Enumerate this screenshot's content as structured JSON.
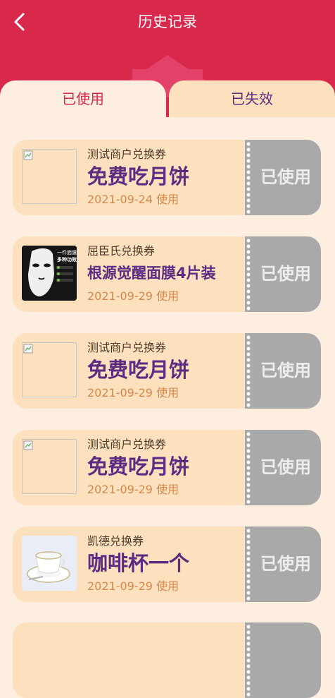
{
  "header": {
    "title": "历史记录",
    "background_color": "#d8284c"
  },
  "tabs": [
    {
      "label": "已使用",
      "active": true
    },
    {
      "label": "已失效",
      "active": false
    }
  ],
  "coupons": [
    {
      "merchant": "测试商户兑换券",
      "name": "免费吃月饼",
      "date": "2021-09-24 使用",
      "status": "已使用",
      "image": "broken"
    },
    {
      "merchant": "屈臣氏兑换券",
      "name": "根源觉醒面膜4片装",
      "date": "2021-09-29 使用",
      "status": "已使用",
      "image": "face-mask",
      "image_caption_line1": "一件面膜",
      "image_caption_line2": "多种功效"
    },
    {
      "merchant": "测试商户兑换券",
      "name": "免费吃月饼",
      "date": "2021-09-29 使用",
      "status": "已使用",
      "image": "broken"
    },
    {
      "merchant": "测试商户兑换券",
      "name": "免费吃月饼",
      "date": "2021-09-29 使用",
      "status": "已使用",
      "image": "broken"
    },
    {
      "merchant": "凯德兑换券",
      "name": "咖啡杯一个",
      "date": "2021-09-29 使用",
      "status": "已使用",
      "image": "coffee-cup"
    }
  ],
  "colors": {
    "accent": "#d8284c",
    "purple_text": "#5a2d82",
    "date_text": "#d4894a",
    "card_background": "#fde0bd",
    "used_stub": "#a9a9a9"
  }
}
